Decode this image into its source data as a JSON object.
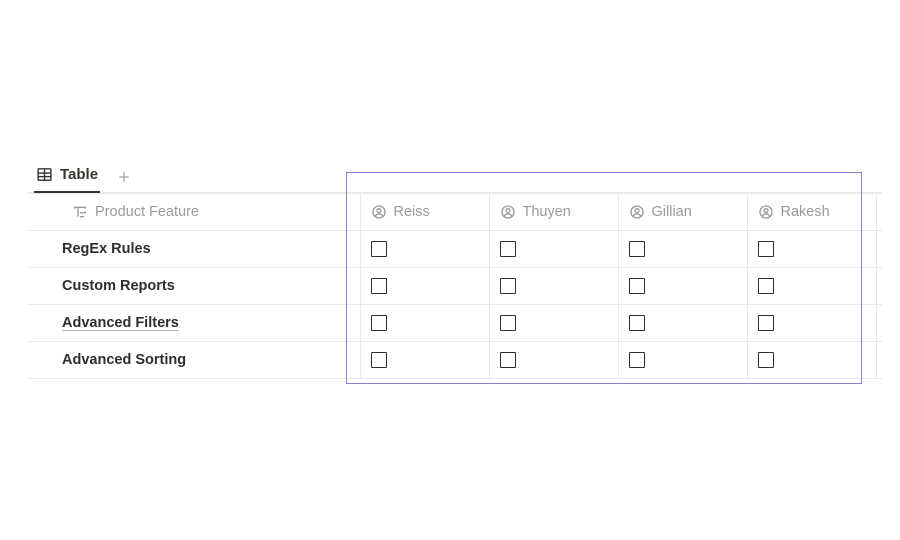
{
  "tabs": {
    "main_label": "Table"
  },
  "columns": {
    "name_header": "Product Feature",
    "people": [
      "Reiss",
      "Thuyen",
      "Gillian",
      "Rakesh"
    ]
  },
  "rows": [
    {
      "name": "RegEx Rules",
      "underlined": false,
      "checks": [
        false,
        false,
        false,
        false
      ]
    },
    {
      "name": "Custom Reports",
      "underlined": false,
      "checks": [
        false,
        false,
        false,
        false
      ]
    },
    {
      "name": "Advanced Filters",
      "underlined": true,
      "checks": [
        false,
        false,
        false,
        false
      ]
    },
    {
      "name": "Advanced Sorting",
      "underlined": false,
      "checks": [
        false,
        false,
        false,
        false
      ]
    }
  ],
  "chart_data": {
    "type": "table",
    "title": "Product Feature",
    "columns": [
      "Product Feature",
      "Reiss",
      "Thuyen",
      "Gillian",
      "Rakesh"
    ],
    "rows": [
      [
        "RegEx Rules",
        false,
        false,
        false,
        false
      ],
      [
        "Custom Reports",
        false,
        false,
        false,
        false
      ],
      [
        "Advanced Filters",
        false,
        false,
        false,
        false
      ],
      [
        "Advanced Sorting",
        false,
        false,
        false,
        false
      ]
    ]
  },
  "colors": {
    "highlight_border": "#8a7cd8"
  }
}
